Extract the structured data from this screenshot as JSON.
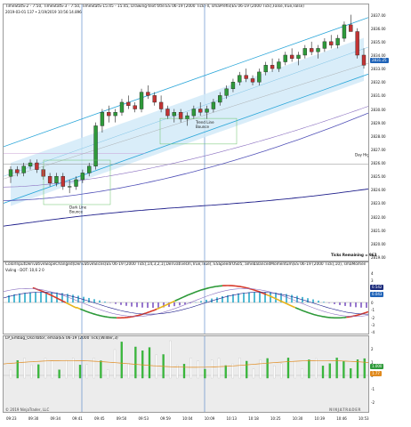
{
  "price_pane": {
    "header": "TimeStatS-2 - 7:50, TimeStatS-3 -  7:50, TimeStatS-15:45 - 15:45, Drawing-text title:ES 06-19 (2000 Tick)-ll, smaPrefix(ES 06-19 (2000 Tick),False,True,False)",
    "subheader": "2019-03-01 137 • 2/19/2019 10:56:14.896",
    "annotations": {
      "low_line": "Dark Line\nBounce",
      "trend_bounce": "Trend Line\nBounce",
      "day_high": "Day High"
    },
    "current_price": "2831.25",
    "y_ticks": [
      "2837.00",
      "2836.00",
      "2835.00",
      "2834.00",
      "2833.00",
      "2832.00",
      "2831.00",
      "2830.00",
      "2829.00",
      "2828.00",
      "2827.00",
      "2826.00",
      "2825.00",
      "2824.00",
      "2823.00",
      "2822.00",
      "2821.00",
      "2820.00",
      "2819.00"
    ],
    "ticks_remaining": "Ticks Remaining = 963"
  },
  "osc_pane": {
    "header": "ColorInputDerivativeSlopeChanged(DerivativeSlices(ES 06-19 (2000 Tick),14,3,2,1),DerivativeOn,True,True), ESSpeedrOS05, amebalancedMomentum(ES 06-19 (2000 Tick),10), smaMomentum(ES 06-19 (2000 Tick),14,7)",
    "subheader": "Vuling - DOT: 10,6 2 0",
    "y_ticks": [
      "4",
      "3",
      "2",
      "1",
      "0",
      "-1",
      "-2",
      "-3",
      "-4"
    ],
    "tag_upper": "0.542",
    "tag_lower": "0.043"
  },
  "vol_pane": {
    "header": "LP_Embag_Oscillator, emaa(ES 06-19 (2000 Tick),Wilder,3)",
    "y_ticks": [
      "2",
      "1",
      "0",
      "-1",
      "-2"
    ],
    "tag_green": "1.000",
    "tag_orange": "1.77"
  },
  "time_axis": [
    "09:23",
    "09:30",
    "09:34",
    "09:41",
    "09:45",
    "09:50",
    "09:53",
    "09:59",
    "10:04",
    "10:09",
    "10:13",
    "10:18",
    "10:25",
    "10:30",
    "10:39",
    "10:46",
    "10:53"
  ],
  "footer": {
    "copyright": "© 2019 NinjaTrader, LLC",
    "brand": "NINJATRADER"
  },
  "colors": {
    "up_candle": "#2e9a3a",
    "down_candle": "#c23333",
    "channel": "#2aa6d9",
    "channel_fill": "#cfe9f8",
    "ma_dark": "#1d1d8a",
    "ma_mid": "#5252b8",
    "ma_light": "#8a6fc0"
  },
  "chart_data": {
    "type": "candlestick",
    "title": "",
    "ylim": [
      2819,
      2837.5
    ],
    "candles": [
      [
        2825.0,
        2825.75,
        2824.5,
        2825.5
      ],
      [
        2825.5,
        2825.75,
        2825.0,
        2825.25
      ],
      [
        2825.25,
        2826.0,
        2825.0,
        2825.75
      ],
      [
        2825.75,
        2826.25,
        2825.5,
        2826.0
      ],
      [
        2826.0,
        2826.25,
        2825.25,
        2825.5
      ],
      [
        2825.5,
        2825.75,
        2824.75,
        2825.0
      ],
      [
        2825.0,
        2825.25,
        2824.25,
        2824.5
      ],
      [
        2824.5,
        2825.25,
        2824.25,
        2825.0
      ],
      [
        2825.0,
        2825.25,
        2824.0,
        2824.25
      ],
      [
        2824.25,
        2824.75,
        2823.75,
        2824.25
      ],
      [
        2824.25,
        2825.0,
        2824.0,
        2824.75
      ],
      [
        2824.75,
        2825.5,
        2824.5,
        2825.25
      ],
      [
        2825.25,
        2826.0,
        2825.0,
        2825.75
      ],
      [
        2825.75,
        2829.0,
        2825.5,
        2828.75
      ],
      [
        2828.75,
        2830.0,
        2828.25,
        2829.75
      ],
      [
        2829.75,
        2830.25,
        2829.0,
        2829.5
      ],
      [
        2829.5,
        2830.0,
        2829.0,
        2829.75
      ],
      [
        2829.75,
        2830.75,
        2829.5,
        2830.5
      ],
      [
        2830.5,
        2831.0,
        2830.0,
        2830.25
      ],
      [
        2830.25,
        2830.5,
        2829.75,
        2830.0
      ],
      [
        2830.0,
        2831.5,
        2829.75,
        2831.25
      ],
      [
        2831.25,
        2831.75,
        2830.75,
        2831.0
      ],
      [
        2831.0,
        2831.25,
        2830.25,
        2830.5
      ],
      [
        2830.5,
        2831.0,
        2829.75,
        2830.0
      ],
      [
        2830.0,
        2830.25,
        2829.25,
        2829.5
      ],
      [
        2829.5,
        2830.0,
        2829.0,
        2829.75
      ],
      [
        2829.75,
        2830.0,
        2829.0,
        2829.25
      ],
      [
        2829.25,
        2829.75,
        2828.75,
        2829.5
      ],
      [
        2829.5,
        2830.25,
        2829.25,
        2830.0
      ],
      [
        2830.0,
        2830.5,
        2829.5,
        2829.75
      ],
      [
        2829.75,
        2830.25,
        2829.25,
        2830.0
      ],
      [
        2830.0,
        2830.75,
        2829.75,
        2830.5
      ],
      [
        2830.5,
        2831.25,
        2830.25,
        2831.0
      ],
      [
        2831.0,
        2831.75,
        2830.75,
        2831.5
      ],
      [
        2831.5,
        2832.25,
        2831.25,
        2832.0
      ],
      [
        2832.0,
        2832.75,
        2831.75,
        2832.5
      ],
      [
        2832.5,
        2833.0,
        2832.0,
        2832.25
      ],
      [
        2832.25,
        2832.5,
        2831.75,
        2832.0
      ],
      [
        2832.0,
        2833.0,
        2831.75,
        2832.75
      ],
      [
        2832.75,
        2833.5,
        2832.5,
        2833.25
      ],
      [
        2833.25,
        2833.75,
        2832.75,
        2833.0
      ],
      [
        2833.0,
        2833.75,
        2832.75,
        2833.5
      ],
      [
        2833.5,
        2834.25,
        2833.25,
        2834.0
      ],
      [
        2834.0,
        2834.5,
        2833.5,
        2833.75
      ],
      [
        2833.75,
        2834.25,
        2833.25,
        2834.0
      ],
      [
        2834.0,
        2834.75,
        2833.75,
        2834.5
      ],
      [
        2834.5,
        2835.0,
        2834.0,
        2834.25
      ],
      [
        2834.25,
        2834.75,
        2833.75,
        2834.5
      ],
      [
        2834.5,
        2835.25,
        2834.25,
        2835.0
      ],
      [
        2835.0,
        2835.5,
        2834.5,
        2834.75
      ],
      [
        2834.75,
        2835.5,
        2834.5,
        2835.25
      ],
      [
        2835.25,
        2836.5,
        2835.0,
        2836.25
      ],
      [
        2836.25,
        2837.0,
        2835.75,
        2835.75
      ],
      [
        2835.75,
        2836.0,
        2833.75,
        2834.0
      ],
      [
        2834.0,
        2834.5,
        2833.0,
        2833.25
      ]
    ]
  }
}
